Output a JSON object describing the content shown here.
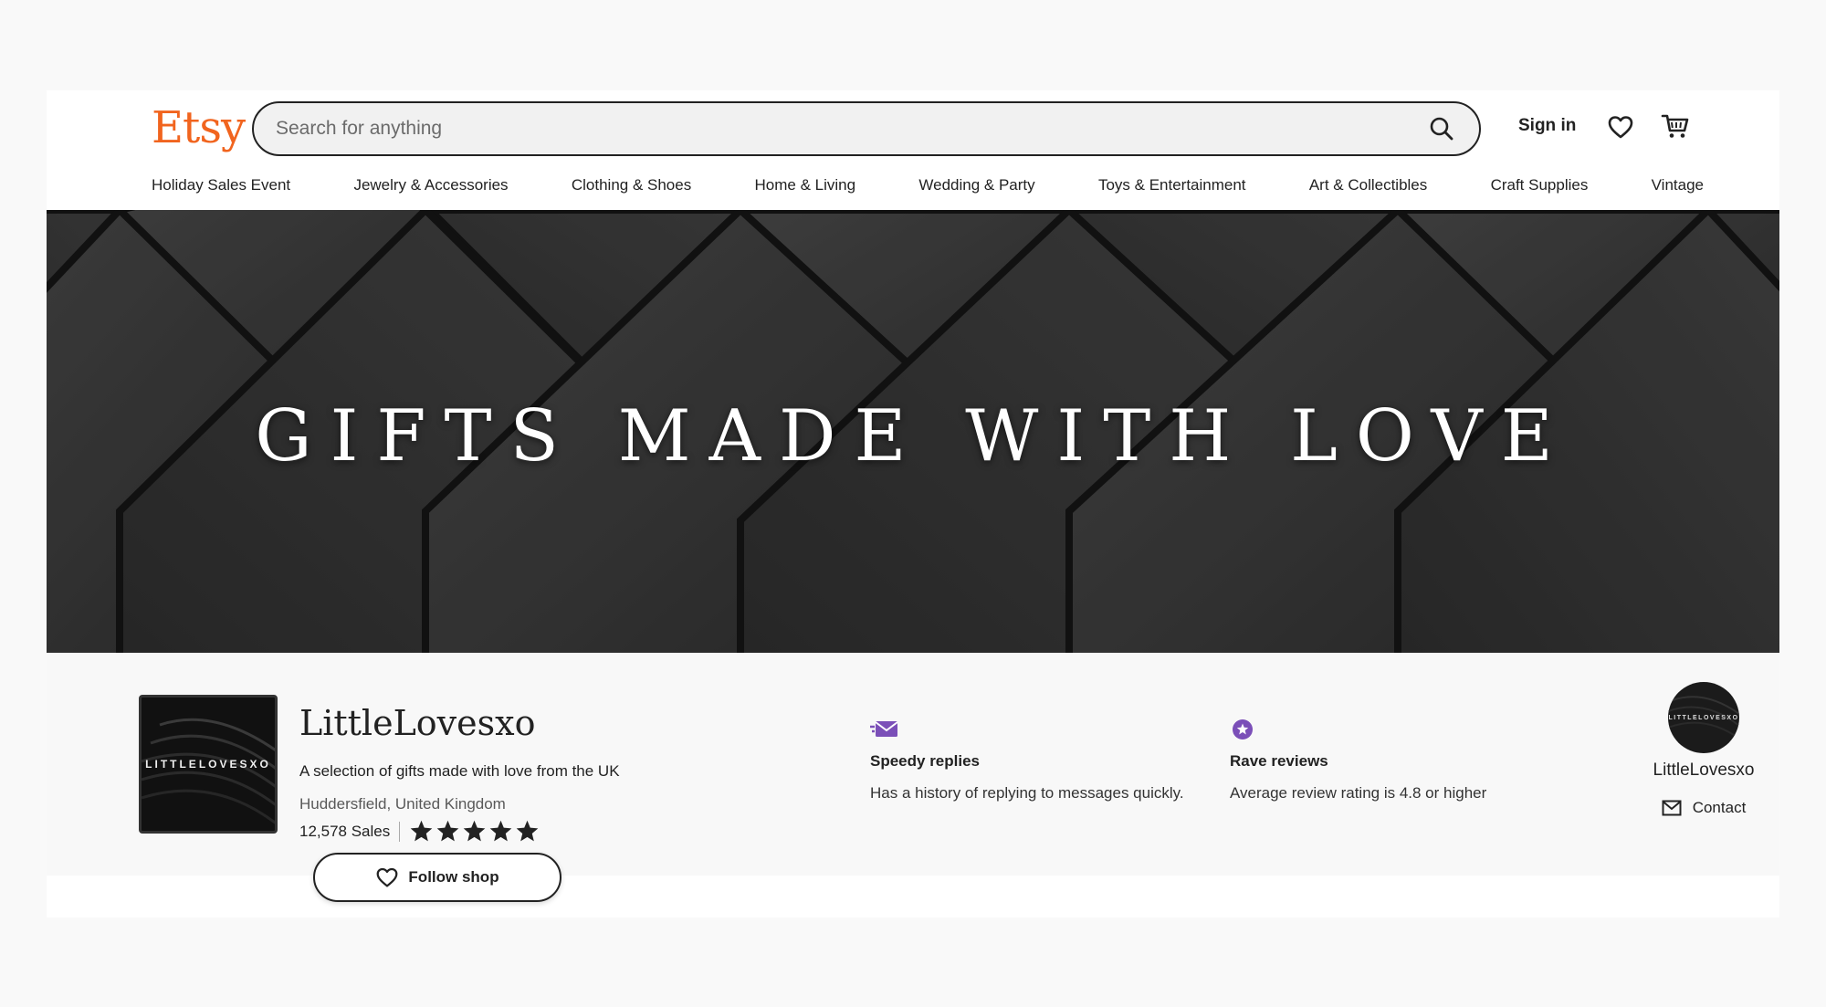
{
  "header": {
    "logo": "Etsy",
    "search_placeholder": "Search for anything",
    "signin_label": "Sign in"
  },
  "categories": [
    "Holiday Sales Event",
    "Jewelry & Accessories",
    "Clothing & Shoes",
    "Home & Living",
    "Wedding & Party",
    "Toys & Entertainment",
    "Art & Collectibles",
    "Craft Supplies",
    "Vintage"
  ],
  "banner": {
    "text": "GIFTS MADE WITH LOVE"
  },
  "shop": {
    "logo_text": "LITTLELOVESXO",
    "name": "LittleLovesxo",
    "description": "A selection of gifts made with love from the UK",
    "location": "Huddersfield, United Kingdom",
    "sales": "12,578 Sales",
    "rating_stars": 5,
    "follow_label": "Follow shop"
  },
  "badges": [
    {
      "title": "Speedy replies",
      "subtitle": "Has a history of replying to messages quickly.",
      "icon": "envelope-speed-icon"
    },
    {
      "title": "Rave reviews",
      "subtitle": "Average review rating is 4.8 or higher",
      "icon": "star-badge-icon"
    }
  ],
  "owner": {
    "avatar_text": "LITTLELOVESXO",
    "name": "LittleLovesxo",
    "contact_label": "Contact"
  },
  "colors": {
    "brand": "#f1641e",
    "badge_purple": "#7b4fb8"
  }
}
